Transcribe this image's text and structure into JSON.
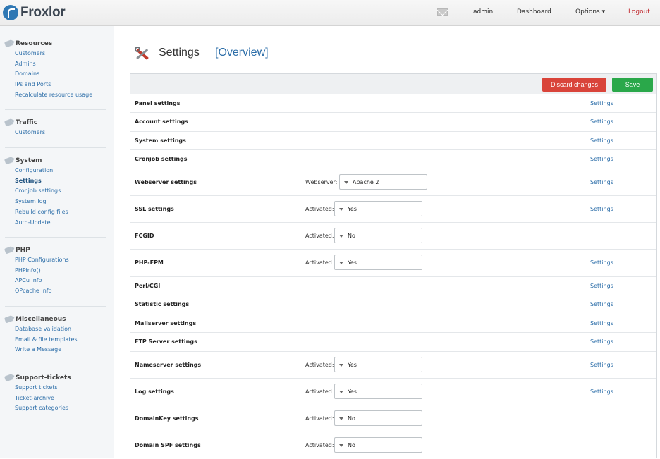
{
  "app": {
    "name": "Froxlor"
  },
  "topnav": {
    "user": "admin",
    "dashboard": "Dashboard",
    "options": "Options ▾",
    "logout": "Logout"
  },
  "sidebar": {
    "groups": [
      {
        "title": "Resources",
        "items": [
          "Customers",
          "Admins",
          "Domains",
          "IPs and Ports",
          "Recalculate resource usage"
        ]
      },
      {
        "title": "Traffic",
        "items": [
          "Customers"
        ]
      },
      {
        "title": "System",
        "items": [
          "Configuration",
          "Settings",
          "Cronjob settings",
          "System log",
          "Rebuild config files",
          "Auto-Update"
        ]
      },
      {
        "title": "PHP",
        "items": [
          "PHP Configurations",
          "PHPinfo()",
          "APCu info",
          "OPcache Info"
        ]
      },
      {
        "title": "Miscellaneous",
        "items": [
          "Database validation",
          "Email & file templates",
          "Write a Message"
        ]
      },
      {
        "title": "Support-tickets",
        "items": [
          "Support tickets",
          "Ticket-archive",
          "Support categories"
        ]
      }
    ]
  },
  "page": {
    "title": "Settings",
    "overview": "[Overview]"
  },
  "toolbar": {
    "discard": "Discard changes",
    "save": "Save"
  },
  "rows": [
    {
      "label": "Panel settings",
      "link": "Settings"
    },
    {
      "label": "Account settings",
      "link": "Settings"
    },
    {
      "label": "System settings",
      "link": "Settings"
    },
    {
      "label": "Cronjob settings",
      "link": "Settings"
    },
    {
      "label": "Webserver settings",
      "link": "Settings",
      "field_label": "Webserver:",
      "value": "Apache 2"
    },
    {
      "label": "SSL settings",
      "link": "Settings",
      "field_label": "Activated:",
      "value": "Yes"
    },
    {
      "label": "FCGID",
      "link": "",
      "field_label": "Activated:",
      "value": "No"
    },
    {
      "label": "PHP-FPM",
      "link": "Settings",
      "field_label": "Activated:",
      "value": "Yes"
    },
    {
      "label": "Perl/CGI",
      "link": "Settings"
    },
    {
      "label": "Statistic settings",
      "link": "Settings"
    },
    {
      "label": "Mailserver settings",
      "link": "Settings"
    },
    {
      "label": "FTP Server settings",
      "link": "Settings"
    },
    {
      "label": "Nameserver settings",
      "link": "Settings",
      "field_label": "Activated:",
      "value": "Yes"
    },
    {
      "label": "Log settings",
      "link": "Settings",
      "field_label": "Activated:",
      "value": "Yes"
    },
    {
      "label": "DomainKey settings",
      "link": "",
      "field_label": "Activated:",
      "value": "No"
    },
    {
      "label": "Domain SPF settings",
      "link": "",
      "field_label": "Activated:",
      "value": "No"
    }
  ]
}
